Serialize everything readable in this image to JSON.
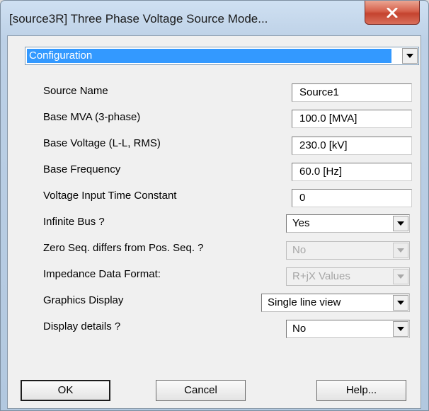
{
  "window": {
    "title": "[source3R] Three Phase Voltage Source Mode..."
  },
  "category": {
    "selected": "Configuration"
  },
  "params": [
    {
      "label": "Source Name",
      "value": "Source1",
      "kind": "text"
    },
    {
      "label": "Base MVA (3-phase)",
      "value": "100.0 [MVA]",
      "kind": "text"
    },
    {
      "label": "Base Voltage (L-L, RMS)",
      "value": "230.0 [kV]",
      "kind": "text"
    },
    {
      "label": "Base Frequency",
      "value": "60.0 [Hz]",
      "kind": "text"
    },
    {
      "label": "Voltage Input Time Constant",
      "value": "0",
      "kind": "text"
    },
    {
      "label": "Infinite Bus ?",
      "value": "Yes",
      "kind": "select"
    },
    {
      "label": "Zero Seq. differs from Pos. Seq. ?",
      "value": "No",
      "kind": "select",
      "disabled": true
    },
    {
      "label": "Impedance Data Format:",
      "value": "R+jX Values",
      "kind": "select",
      "disabled": true
    },
    {
      "label": "Graphics Display",
      "value": "Single line view",
      "kind": "select"
    },
    {
      "label": "Display details ?",
      "value": "No",
      "kind": "select"
    }
  ],
  "buttons": {
    "ok": "OK",
    "cancel": "Cancel",
    "help": "Help..."
  },
  "icons": {
    "close": "close-x-icon",
    "dropdown": "chevron-down-icon"
  },
  "colors": {
    "selection": "#3399ff",
    "close_button": "#c4432f",
    "dialog_background": "#f0f0f0"
  }
}
